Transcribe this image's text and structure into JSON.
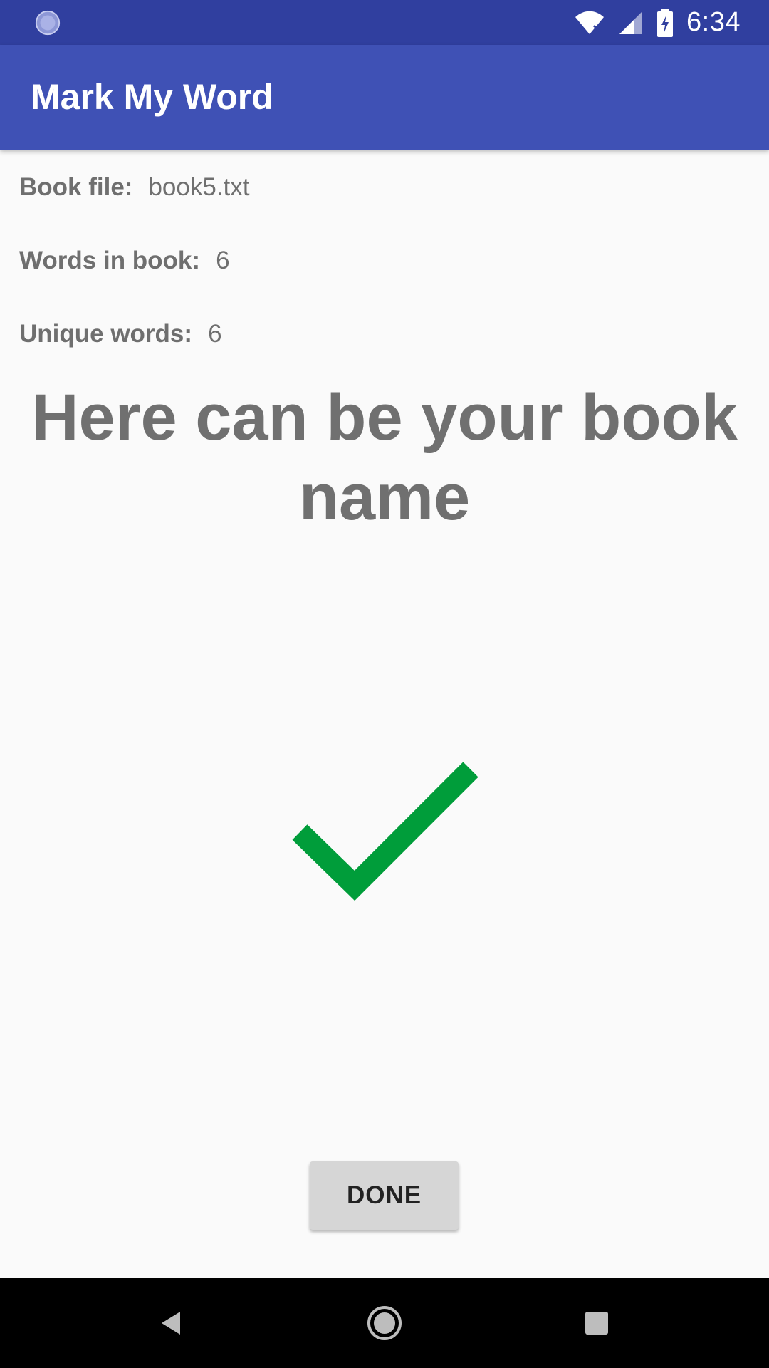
{
  "status_bar": {
    "time": "6:34",
    "icons": [
      "sync-icon",
      "wifi-off-icon",
      "cell-signal-icon",
      "battery-charging-icon"
    ]
  },
  "app_bar": {
    "title": "Mark My Word"
  },
  "info": {
    "book_file_label": "Book file:",
    "book_file_value": "book5.txt",
    "words_label": "Words in book:",
    "words_value": "6",
    "unique_label": "Unique words:",
    "unique_value": "6"
  },
  "book_name": "Here can be your book name",
  "status_icon": "check-icon",
  "done_button": {
    "label": "DONE"
  },
  "nav_bar": {
    "icons": [
      "back-icon",
      "home-icon",
      "recent-apps-icon"
    ]
  },
  "colors": {
    "status_bar": "#303f9f",
    "app_bar": "#3f51b5",
    "check": "#009d3a",
    "background": "#fafafa",
    "button": "#d6d6d6"
  }
}
